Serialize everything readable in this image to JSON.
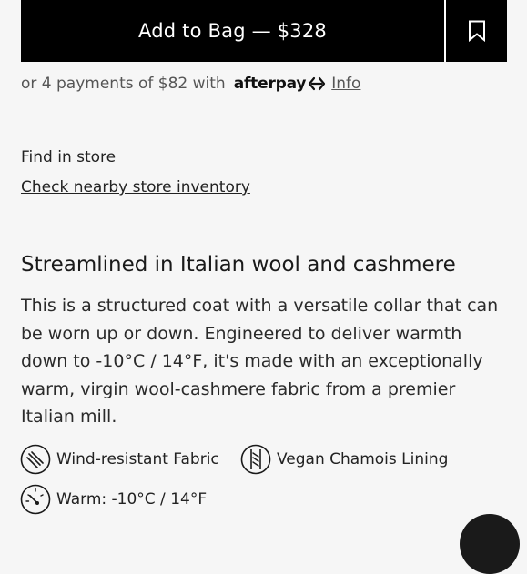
{
  "purchase": {
    "add_to_bag_label": "Add to Bag — $328",
    "bookmark_icon": "bookmark-icon"
  },
  "payments": {
    "installments_text": "or 4 payments of $82 with",
    "provider_logo_text": "afterpay",
    "info_link": "Info"
  },
  "store": {
    "find_label": "Find in store",
    "inventory_link": "Check nearby store inventory"
  },
  "product": {
    "headline": "Streamlined in Italian wool and cashmere",
    "description": "This is a structured coat with a versatile collar that can be worn up or down. Engineered to deliver warmth down to -10°C / 14°F, it's made with an exceptionally warm, virgin wool-cashmere fabric from a premier Italian mill."
  },
  "features": [
    {
      "icon": "wind-resistant-icon",
      "label": "Wind-resistant Fabric"
    },
    {
      "icon": "lining-icon",
      "label": "Vegan Chamois Lining"
    },
    {
      "icon": "temperature-gauge-icon",
      "label": "Warm: -10°C / 14°F"
    }
  ],
  "chat": {
    "icon": "chat-icon"
  },
  "colors": {
    "button_bg": "#000000",
    "button_text": "#ffffff",
    "page_bg": "#f6f6f6",
    "text": "#1f1f1f"
  }
}
